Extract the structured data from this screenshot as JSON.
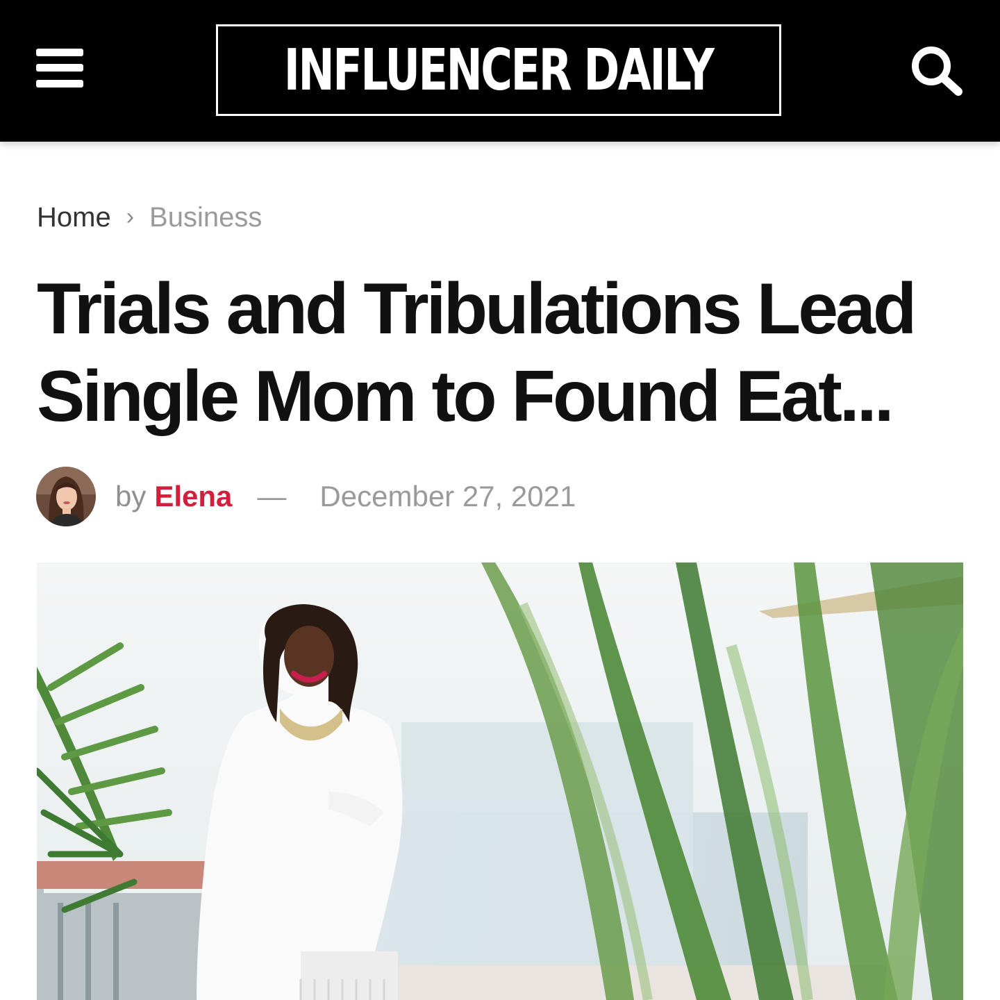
{
  "header": {
    "logo_text": "INFLUENCER DAILY",
    "menu_icon": "hamburger-menu-icon",
    "search_icon": "search-icon",
    "background_color": "#000000"
  },
  "breadcrumb": {
    "home": "Home",
    "separator": "›",
    "current": "Business"
  },
  "article": {
    "title": "Trials and Tribulations Lead Single Mom to Found Eat...",
    "byline_prefix": "by",
    "author": "Elena",
    "separator": "—",
    "date": "December 27, 2021",
    "author_color": "#d21f3c"
  }
}
